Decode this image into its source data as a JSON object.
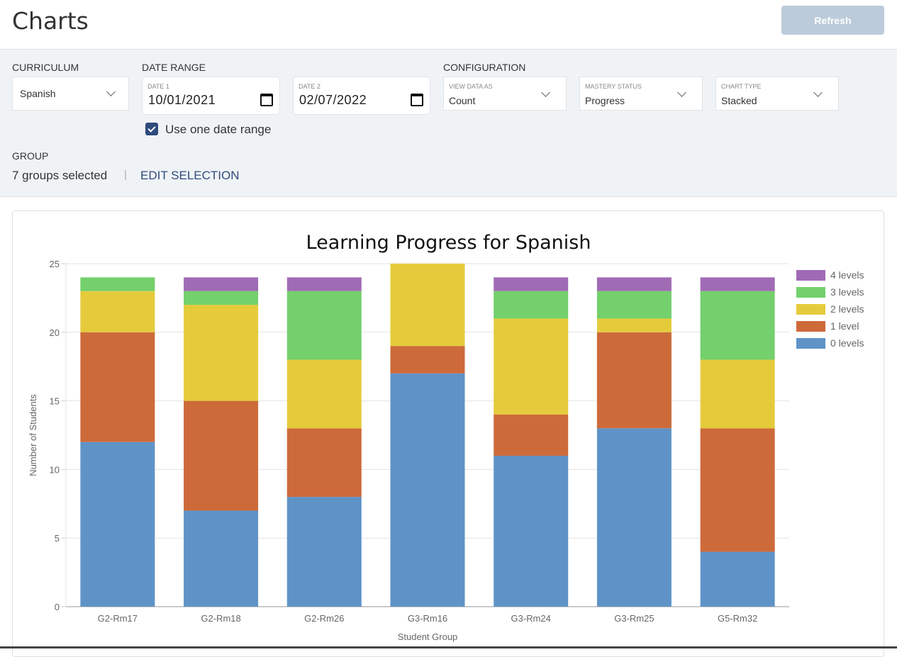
{
  "page": {
    "title": "Charts",
    "refresh_label": "Refresh"
  },
  "filters": {
    "curriculum": {
      "label": "CURRICULUM",
      "value": "Spanish"
    },
    "date_range": {
      "label": "DATE RANGE",
      "date1": {
        "label": "DATE 1",
        "value": "10/01/2021"
      },
      "date2": {
        "label": "DATE 2",
        "value": "02/07/2022"
      },
      "use_one_range": {
        "label": "Use one date range",
        "checked": true
      }
    },
    "configuration": {
      "label": "CONFIGURATION",
      "view_data_as": {
        "label": "VIEW DATA AS",
        "value": "Count"
      },
      "mastery_status": {
        "label": "MASTERY STATUS",
        "value": "Progress"
      },
      "chart_type": {
        "label": "CHART TYPE",
        "value": "Stacked"
      }
    },
    "group": {
      "label": "GROUP",
      "summary": "7 groups selected",
      "separator": "|",
      "edit_label": "EDIT SELECTION"
    }
  },
  "chart_data": {
    "type": "bar",
    "stacked": true,
    "title": "Learning Progress for Spanish",
    "xlabel": "Student Group",
    "ylabel": "Number of Students",
    "ylim": [
      0,
      25
    ],
    "yticks": [
      0,
      5,
      10,
      15,
      20,
      25
    ],
    "grid": true,
    "legend_position": "right",
    "categories": [
      "G2-Rm17",
      "G2-Rm18",
      "G2-Rm26",
      "G3-Rm16",
      "G3-Rm24",
      "G3-Rm25",
      "G5-Rm32"
    ],
    "series": [
      {
        "name": "0 levels",
        "color": "#5f93c7",
        "values": [
          12,
          7,
          8,
          17,
          11,
          13,
          4
        ]
      },
      {
        "name": "1 level",
        "color": "#cd6a3a",
        "values": [
          8,
          8,
          5,
          2,
          3,
          7,
          9
        ]
      },
      {
        "name": "2 levels",
        "color": "#e5cb3c",
        "values": [
          3,
          7,
          5,
          6,
          7,
          1,
          5
        ]
      },
      {
        "name": "3 levels",
        "color": "#73d06c",
        "values": [
          1,
          1,
          5,
          0,
          2,
          2,
          5
        ]
      },
      {
        "name": "4 levels",
        "color": "#a06bb5",
        "values": [
          0,
          1,
          1,
          0,
          1,
          1,
          1
        ]
      }
    ],
    "legend_order": [
      "4 levels",
      "3 levels",
      "2 levels",
      "1 level",
      "0 levels"
    ]
  }
}
